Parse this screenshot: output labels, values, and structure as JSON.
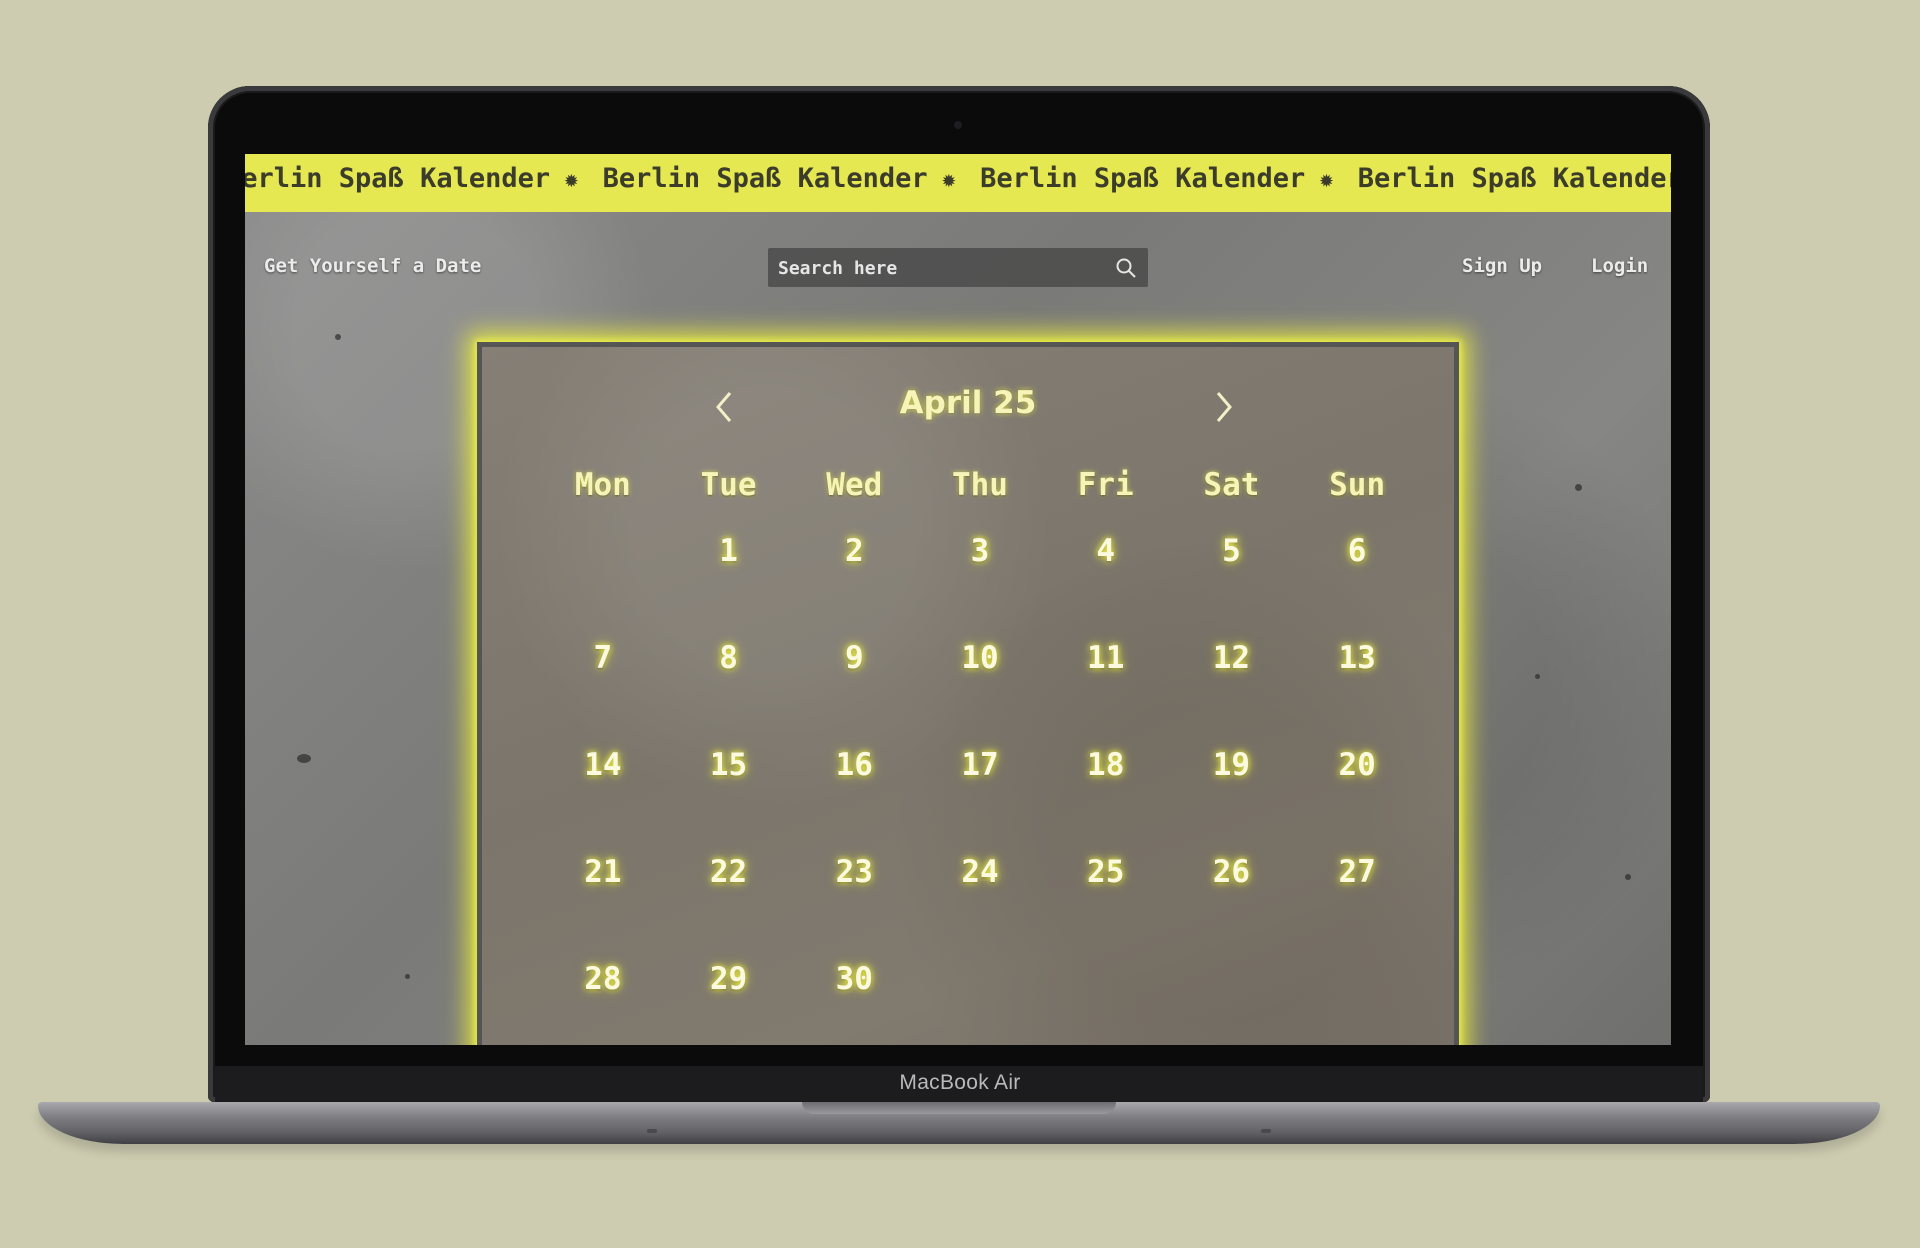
{
  "device": {
    "label": "MacBook Air"
  },
  "marquee": {
    "text": "Berlin Spaß Kalender",
    "icon": "fire-icon",
    "repeat": 5
  },
  "nav": {
    "brand": "Get Yourself a Date",
    "search_placeholder": "Search here",
    "signup": "Sign Up",
    "login": "Login"
  },
  "calendar": {
    "title": "April 25",
    "weekdays": [
      "Mon",
      "Tue",
      "Wed",
      "Thu",
      "Fri",
      "Sat",
      "Sun"
    ],
    "first_weekday_offset": 1,
    "days": [
      1,
      2,
      3,
      4,
      5,
      6,
      7,
      8,
      9,
      10,
      11,
      12,
      13,
      14,
      15,
      16,
      17,
      18,
      19,
      20,
      21,
      22,
      23,
      24,
      25,
      26,
      27,
      28,
      29,
      30
    ]
  },
  "colors": {
    "accent": "#e6e852",
    "glow": "#f6f4b8"
  }
}
